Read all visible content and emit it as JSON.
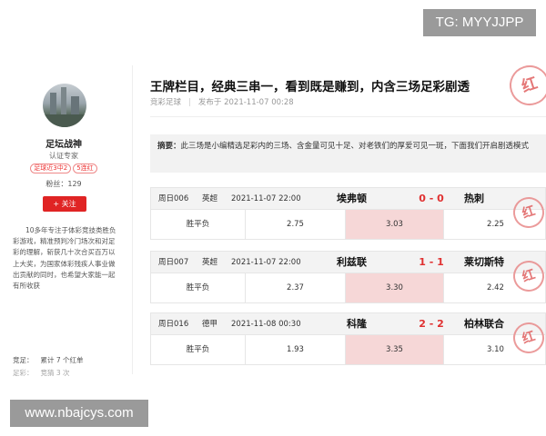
{
  "watermarks": {
    "top": "TG: MYYJJPP",
    "bottom": "www.nbajcys.com"
  },
  "author": {
    "name": "足坛战神",
    "title": "认证专家",
    "badges": [
      "足球近3中2",
      "5连红"
    ],
    "fans": "粉丝：129",
    "follow_label": "+ 关注",
    "bio": "10多年专注于体彩竞技类胜负彩游戏，精准预判冷门场次和对足彩的理解，斩获几十次合买百万以上大奖，为国家体彩残疾人事业做出贡献的同时，也希望大家能一起有所收获",
    "record_label": "竞足：",
    "record_value": "累计 7 个红单",
    "record_label2": "足彩：",
    "record_value2": "竞猜 3 次"
  },
  "article": {
    "title": "王牌栏目，经典三串一，看到既是赚到，内含三场足彩剧透",
    "category": "竞彩足球",
    "published": "发布于 2021-11-07 00:28",
    "summary_label": "摘要：",
    "summary": "此三场是小编精选足彩内的三场、含金量可见十足、对老铁们的厚爱可见一斑，下面我们开启剧透模式",
    "stamp": "红"
  },
  "matches": [
    {
      "id": "周日006",
      "league": "英超",
      "time": "2021-11-07 22:00",
      "home": "埃弗顿",
      "score": "0 - 0",
      "away": "热刺",
      "market": "胜平负",
      "odds": [
        "2.75",
        "3.03",
        "2.25"
      ],
      "stamp": "红"
    },
    {
      "id": "周日007",
      "league": "英超",
      "time": "2021-11-07 22:00",
      "home": "利兹联",
      "score": "1 - 1",
      "away": "莱切斯特",
      "market": "胜平负",
      "odds": [
        "2.37",
        "3.30",
        "2.42"
      ],
      "stamp": "红"
    },
    {
      "id": "周日016",
      "league": "德甲",
      "time": "2021-11-08 00:30",
      "home": "科隆",
      "score": "2 - 2",
      "away": "柏林联合",
      "market": "胜平负",
      "odds": [
        "1.93",
        "3.35",
        "3.10"
      ],
      "stamp": "红"
    }
  ],
  "colors": {
    "accent": "#e02424",
    "score": "#e03030",
    "highlight": "#f6d7d7"
  }
}
